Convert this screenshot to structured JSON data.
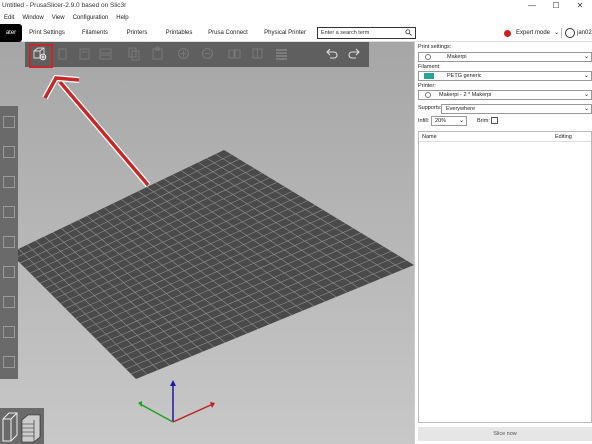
{
  "window": {
    "title": "Untitled - PrusaSlicer-2.9.0 based on Slic3r",
    "minimize": "—",
    "maximize": "☐",
    "close": "✕"
  },
  "menu": [
    "Edit",
    "Window",
    "View",
    "Configuration",
    "Help"
  ],
  "tabs": {
    "plater": "ater",
    "print_settings": "Print Settings",
    "filaments": "Filaments",
    "printers": "Printers",
    "printables": "Printables",
    "prusa_connect": "Prusa Connect",
    "physical_printer": "Physical Printer"
  },
  "search": {
    "placeholder": "Enter a search term"
  },
  "mode": {
    "label": "Expert mode",
    "color": "#d02020"
  },
  "user": {
    "name": "jan02"
  },
  "sidebar": {
    "print_settings_label": "Print settings:",
    "print_settings_value": "Makerpi",
    "filament_label": "Filament:",
    "filament_value": "PETG generic",
    "filament_color": "#26a69a",
    "printer_label": "Printer:",
    "printer_value": "Makerpi - 2 * Makerpi",
    "supports_label": "Supports:",
    "supports_value": "Everywhere",
    "infill_label": "Infill:",
    "infill_value": "20%",
    "brim_label": "Brim:",
    "list_col_name": "Name",
    "list_col_editing": "Editing",
    "slice_button": "Slice now"
  },
  "toolbar": {
    "icons": [
      "add-icon",
      "delete-icon",
      "delete-all-icon",
      "arrange-icon",
      "copy-icon",
      "paste-icon",
      "add-instance-icon",
      "remove-instance-icon",
      "split-objects-icon",
      "split-parts-icon",
      "layer-editing-icon",
      "undo-icon",
      "redo-icon"
    ]
  },
  "annotation": {
    "color": "#c62828",
    "target": "add-icon"
  }
}
